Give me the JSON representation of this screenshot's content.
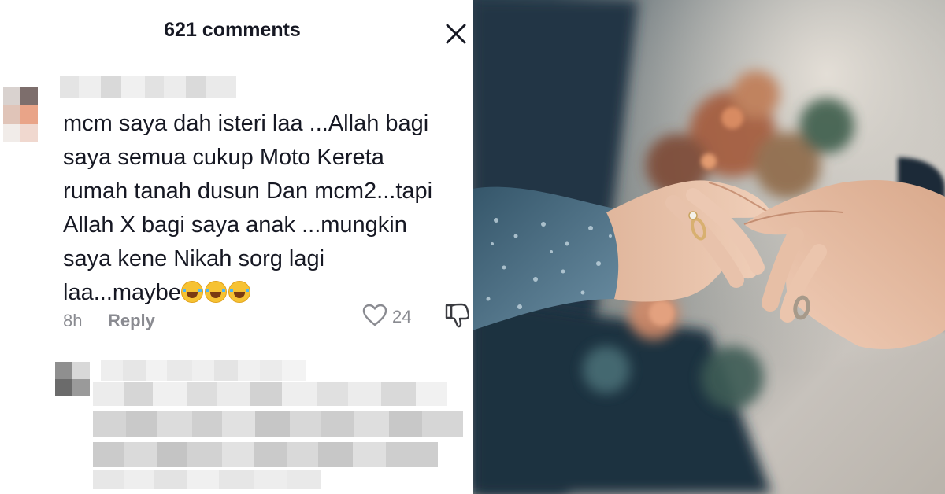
{
  "comments_panel": {
    "title": "621 comments",
    "close_icon": "close-icon"
  },
  "comment": {
    "lines": [
      "mcm saya dah isteri laa ...Allah bagi",
      "saya semua cukup Moto Kereta",
      "rumah tanah dusun Dan mcm2...tapi",
      "Allah X bagi saya anak ...mungkin",
      "saya kene Nikah sorg lagi",
      "laa...maybe"
    ],
    "emoji": "😂😂😂",
    "time": "8h",
    "reply_label": "Reply",
    "likes": "24",
    "like_icon": "heart-outline-icon",
    "dislike_icon": "thumbs-down-icon"
  },
  "colors": {
    "text_primary": "#161823",
    "text_secondary": "#8a8b91",
    "emoji_face": "#f6c233"
  },
  "photo": {
    "subject": "wedding-hands-ring-photo"
  }
}
